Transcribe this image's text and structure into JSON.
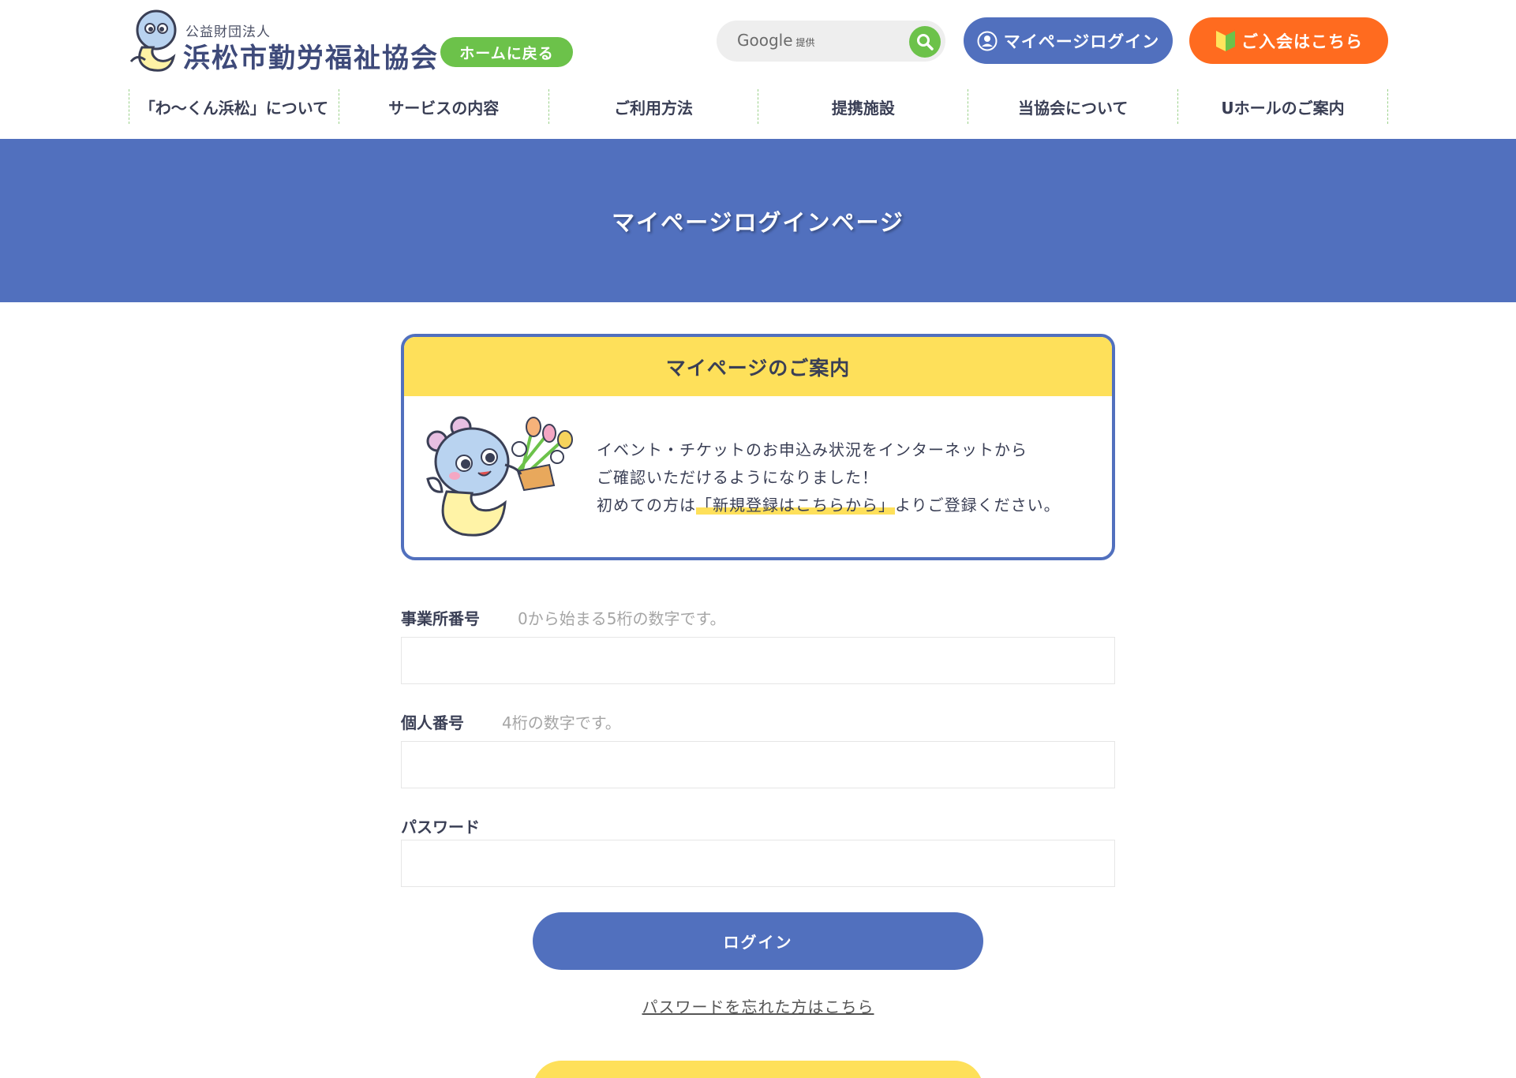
{
  "header": {
    "org_sub": "公益財団法人",
    "org_name": "浜松市勤労福祉協会",
    "home_button": "ホームに戻る",
    "search": {
      "brand": "Google",
      "provided": "提供",
      "placeholder": ""
    },
    "login_button": "マイページログイン",
    "join_button": "ご入会はこちら"
  },
  "nav": {
    "items": [
      {
        "label": "「わ～くん浜松」について"
      },
      {
        "label": "サービスの内容"
      },
      {
        "label": "ご利用方法"
      },
      {
        "label": "提携施設"
      },
      {
        "label": "当協会について"
      },
      {
        "label": "Uホールのご案内"
      }
    ]
  },
  "hero": {
    "title": "マイページログインページ"
  },
  "info": {
    "heading": "マイページのご案内",
    "line1": "イベント・チケットのお申込み状況をインターネットから",
    "line2": "ご確認いただけるようになりました！",
    "line3_pre": "初めての方は",
    "line3_link": "「新規登録はこちらから」",
    "line3_post": "よりご登録ください。"
  },
  "form": {
    "office_label": "事業所番号",
    "office_hint": "0から始まる5桁の数字です。",
    "office_value": "",
    "personal_label": "個人番号",
    "personal_hint": "4桁の数字です。",
    "personal_value": "",
    "password_label": "パスワード",
    "password_value": "",
    "submit": "ログイン",
    "forgot": "パスワードを忘れた方はこちら"
  },
  "colors": {
    "primary_blue": "#5170be",
    "accent_green": "#6cc24a",
    "accent_orange": "#ff6b1f",
    "accent_yellow": "#fee05a"
  }
}
